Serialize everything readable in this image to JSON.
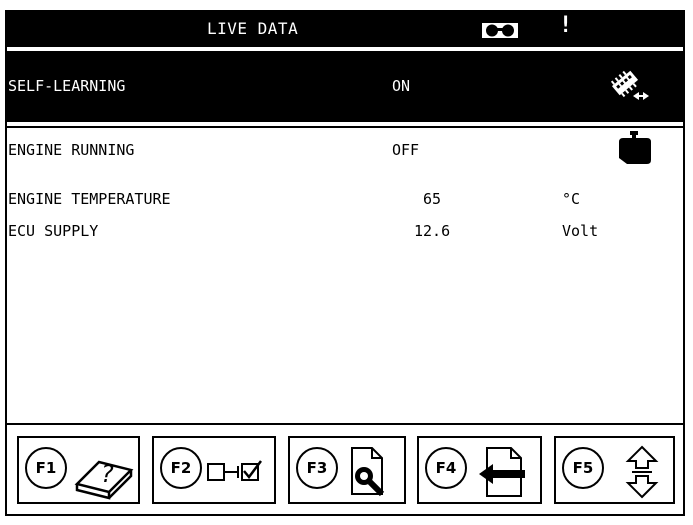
{
  "header": {
    "title": "LIVE DATA",
    "alert_symbol": "!",
    "icons": [
      "glasses-icon"
    ]
  },
  "rows": [
    {
      "name": "SELF-LEARNING",
      "value": "ON",
      "unit": "",
      "icon": "memory-chip-icon",
      "selected": true
    },
    {
      "name": "ENGINE RUNNING",
      "value": "OFF",
      "unit": "",
      "icon": "engine-block-icon",
      "selected": false
    },
    {
      "name": "ENGINE TEMPERATURE",
      "value": "65",
      "unit": "°C",
      "icon": "",
      "selected": false
    },
    {
      "name": "ECU SUPPLY",
      "value": "12.6",
      "unit": "Volt",
      "icon": "",
      "selected": false
    }
  ],
  "function_keys": [
    {
      "label": "F1",
      "icon": "help-book-icon"
    },
    {
      "label": "F2",
      "icon": "select-checkbox-icon"
    },
    {
      "label": "F3",
      "icon": "magnify-document-icon"
    },
    {
      "label": "F4",
      "icon": "back-arrow-icon"
    },
    {
      "label": "F5",
      "icon": "up-down-arrows-icon"
    }
  ],
  "colors": {
    "background": "#ffffff",
    "foreground": "#000000",
    "highlight_bg": "#000000",
    "highlight_fg": "#ffffff"
  }
}
